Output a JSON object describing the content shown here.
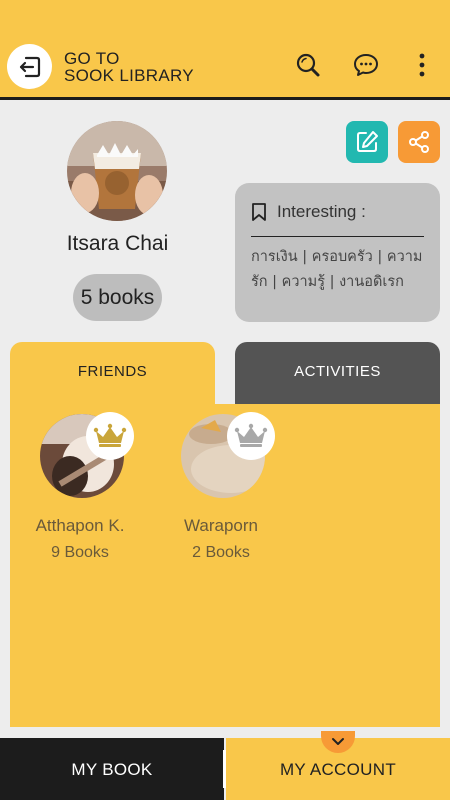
{
  "header": {
    "title_line1": "GO TO",
    "title_line2": "SOOK LIBRARY",
    "icons": [
      "back-icon",
      "search-icon",
      "chat-icon",
      "more-vertical-icon"
    ]
  },
  "profile": {
    "name": "Itsara Chai",
    "books": "5 books",
    "avatar_icon": "profile-photo"
  },
  "actions": {
    "edit_icon": "edit-icon",
    "share_icon": "share-icon"
  },
  "interests": {
    "label": "Interesting :",
    "tags": "การเงิน | ครอบครัว | ความรัก | ความรู้ | งานอดิเรก"
  },
  "tabs": {
    "friends": "FRIENDS",
    "activities": "ACTIVITIES"
  },
  "friends": [
    {
      "name": "Atthapon K.",
      "books": "9 Books",
      "crown_color": "#c9a53a"
    },
    {
      "name": "Waraporn",
      "books": "2 Books",
      "crown_color": "#a8a8a8"
    }
  ],
  "bottom_nav": {
    "left": "MY BOOK",
    "right": "MY ACCOUNT"
  },
  "colors": {
    "primary": "#f9c74a",
    "dark": "#1c1c1c",
    "teal": "#22b8b0",
    "orange": "#f79a36",
    "tab_inactive": "#545454"
  }
}
